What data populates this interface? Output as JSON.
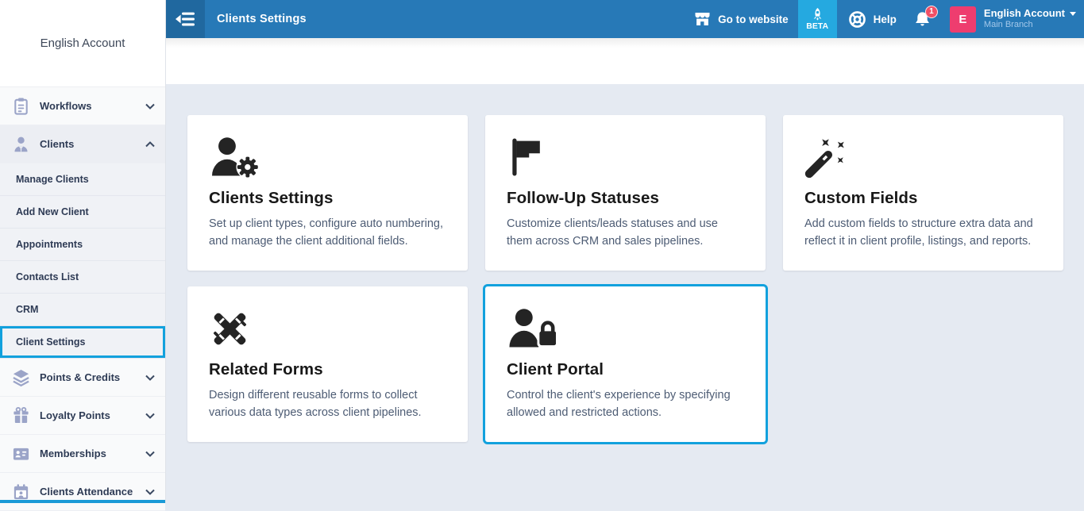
{
  "colors": {
    "topbar": "#2779b7",
    "topbar_dark": "#20689f",
    "beta_bg": "#25a9e0",
    "accent_highlight": "#12a1dd",
    "avatar_bg": "#ee3d6f",
    "badge_bg": "#f05066",
    "page_bg": "#e5eaf2"
  },
  "topbar": {
    "title": "Clients Settings",
    "go_to_website_label": "Go to website",
    "beta_label": "BETA",
    "help_label": "Help",
    "notifications_count": "1",
    "avatar_initial": "E",
    "account_name": "English Account",
    "branch_name": "Main Branch"
  },
  "sidebar": {
    "account_name": "English Account",
    "items": [
      {
        "label": "Workflows",
        "icon": "clipboard-icon",
        "state": "collapsed"
      },
      {
        "label": "Clients",
        "icon": "person-icon",
        "state": "expanded",
        "submenu": [
          "Manage Clients",
          "Add New Client",
          "Appointments",
          "Contacts List",
          "CRM",
          "Client Settings"
        ],
        "highlighted_submenu_item": "Client Settings"
      },
      {
        "label": "Points & Credits",
        "icon": "layers-icon",
        "state": "collapsed"
      },
      {
        "label": "Loyalty Points",
        "icon": "gift-icon",
        "state": "collapsed"
      },
      {
        "label": "Memberships",
        "icon": "id-card-icon",
        "state": "collapsed"
      },
      {
        "label": "Clients Attendance",
        "icon": "calendar-person-icon",
        "state": "collapsed"
      }
    ]
  },
  "main": {
    "cards": [
      {
        "title": "Clients Settings",
        "icon": "user-gear-icon",
        "highlighted": false,
        "description": "Set up client types, configure auto numbering, and manage the client additional fields."
      },
      {
        "title": "Follow-Up Statuses",
        "icon": "flag-icon",
        "highlighted": false,
        "description": "Customize clients/leads statuses and use them across CRM and sales pipelines."
      },
      {
        "title": "Custom Fields",
        "icon": "magic-wand-icon",
        "highlighted": false,
        "description": "Add custom fields to structure extra data and reflect it in client profile, listings, and reports."
      },
      {
        "title": "Related Forms",
        "icon": "crossed-tools-icon",
        "highlighted": false,
        "description": "Design different reusable forms to collect various data types across client pipelines."
      },
      {
        "title": "Client Portal",
        "icon": "user-lock-icon",
        "highlighted": true,
        "description": "Control the client's experience by specifying allowed and restricted actions."
      }
    ]
  }
}
